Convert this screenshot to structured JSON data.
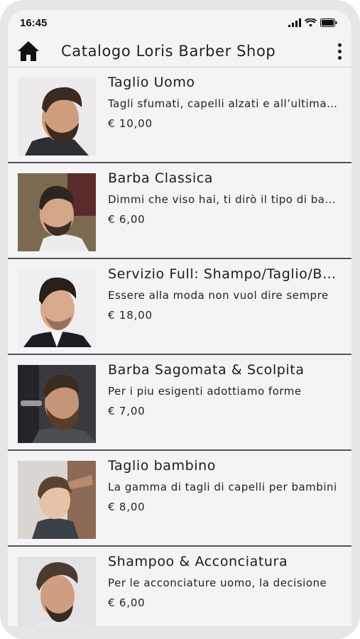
{
  "status_bar": {
    "time": "16:45",
    "icons": [
      "signal-icon",
      "wifi-icon",
      "battery-icon"
    ]
  },
  "app_bar": {
    "home_icon": "home-icon",
    "title": "Catalogo Loris Barber Shop",
    "menu_icon": "more-vert-icon"
  },
  "catalog": {
    "items": [
      {
        "title": "Taglio Uomo",
        "description": "Tagli sfumati, capelli alzati e all’ultima moda",
        "price": "€ 10,00",
        "image": "haircut-man-photo"
      },
      {
        "title": "Barba Classica",
        "description": "Dimmi che viso hai, ti dirò il tipo di barba",
        "price": "€ 6,00",
        "image": "beard-classic-photo"
      },
      {
        "title": "Servizio Full: Shampo/Taglio/Barba",
        "description": "Essere alla moda non vuol dire sempre",
        "price": "€ 18,00",
        "image": "full-service-photo"
      },
      {
        "title": "Barba Sagomata & Scolpita",
        "description": "Per i piu esigenti  adottiamo forme",
        "price": "€ 7,00",
        "image": "beard-sculpted-photo"
      },
      {
        "title": "Taglio bambino",
        "description": "La gamma di tagli di capelli per bambini",
        "price": "€ 8,00",
        "image": "kid-haircut-photo"
      },
      {
        "title": "Shampoo & Acconciatura",
        "description": "Per le acconciature uomo, la decisione",
        "price": "€ 6,00",
        "image": "shampoo-styling-photo"
      }
    ]
  }
}
